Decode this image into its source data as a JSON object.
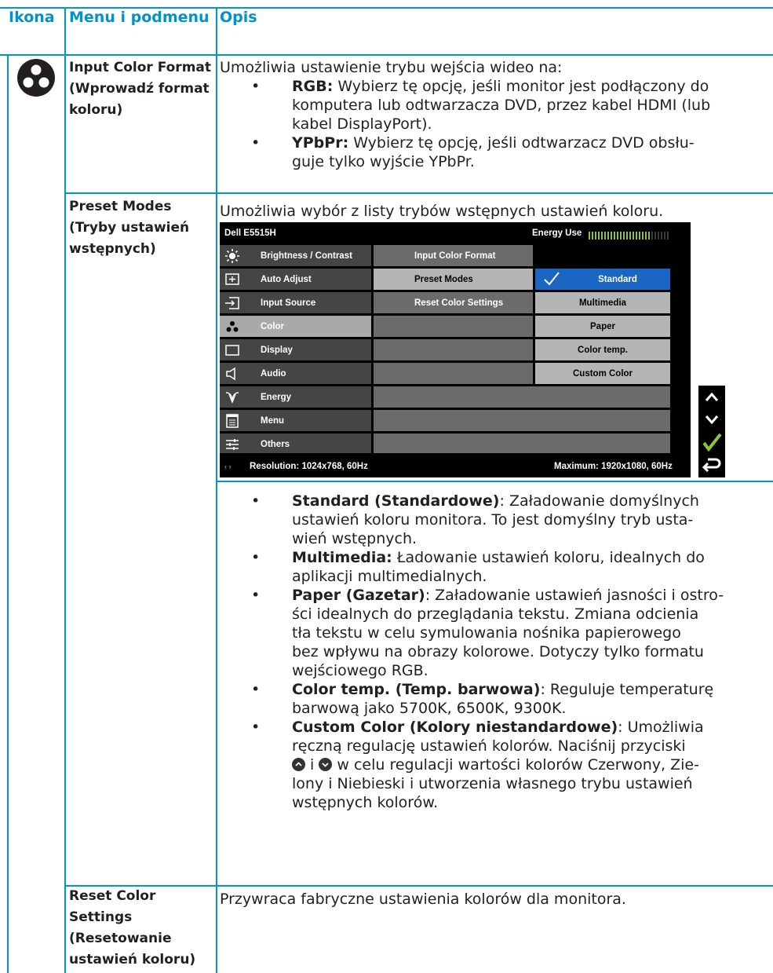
{
  "headers": {
    "icon": "Ikona",
    "menu": "Menu i podmenu",
    "desc": "Opis"
  },
  "row1": {
    "icon": "color-dots-icon",
    "menu": "Input Color Format (Wprowadź format koloru)",
    "intro": "Umożliwia ustawienie trybu wejścia wideo na:",
    "bullets": [
      {
        "term": "RGB:",
        "line1": " Wybierz tę opcję, jeśli monitor jest podłączony do",
        "line2": "komputera lub odtwarzacza DVD, przez kabel HDMI (lub",
        "line3": "kabel DisplayPort)."
      },
      {
        "term": "YPbPr:",
        "line1": " Wybierz tę opcję, jeśli odtwarzacz DVD obsłu-",
        "line2": "guje tylko wyjście YPbPr."
      }
    ]
  },
  "row2": {
    "menu": "Preset Modes (Tryby ustawień wstępnych)",
    "intro": "Umożliwia wybór z listy trybów wstępnych ustawień koloru.",
    "osd": {
      "model": "Dell E5515H",
      "energy_label": "Energy Use",
      "energy_level": 0.78,
      "menu_items": [
        {
          "label": "Brightness / Contrast",
          "icon": "brightness-icon"
        },
        {
          "label": "Auto Adjust",
          "icon": "auto-adjust-icon"
        },
        {
          "label": "Input Source",
          "icon": "input-source-icon"
        },
        {
          "label": "Color",
          "icon": "color-dots-icon"
        },
        {
          "label": "Display",
          "icon": "display-icon"
        },
        {
          "label": "Audio",
          "icon": "audio-icon"
        },
        {
          "label": "Energy",
          "icon": "energy-icon"
        },
        {
          "label": "Menu",
          "icon": "menu-icon"
        },
        {
          "label": "Others",
          "icon": "others-icon"
        }
      ],
      "color_submenu": [
        "Input Color Format",
        "Preset Modes",
        "Reset Color Settings"
      ],
      "preset_options": [
        "Standard",
        "Multimedia",
        "Paper",
        "Color temp.",
        "Custom Color"
      ],
      "resolution": "Resolution: 1024x768, 60Hz",
      "maximum": "Maximum: 1920x1080, 60Hz",
      "nav_buttons": [
        "up-arrow-icon",
        "down-arrow-icon",
        "check-icon",
        "back-icon"
      ]
    },
    "bullets": [
      {
        "term": "Standard (Standardowe)",
        "lines": [
          ": Załadowanie domyślnych",
          "ustawień koloru monitora. To jest domyślny tryb usta-",
          "wień wstępnych."
        ]
      },
      {
        "term": "Multimedia:",
        "lines": [
          " Ładowanie ustawień koloru, idealnych do",
          "aplikacji multimedialnych."
        ]
      },
      {
        "term": "Paper (Gazetar)",
        "lines": [
          ": Załadowanie ustawień jasności i ostro-",
          "ści idealnych do przeglądania tekstu. Zmiana odcienia",
          "tła tekstu w celu symulowania nośnika papierowego",
          "bez wpływu na obrazy kolorowe. Dotyczy tylko formatu",
          "wejściowego RGB."
        ]
      },
      {
        "term": "Color temp. (Temp. barwowa)",
        "lines": [
          ": Reguluje temperaturę",
          "barwową jako 5700K, 6500K, 9300K."
        ]
      },
      {
        "term": "Custom Color (Kolory niestandardowe)",
        "lines": [
          ": Umożliwia",
          "ręczną regulację ustawień kolorów. Naciśnij przyciski"
        ],
        "line_icons_a": " i ",
        "line_icons_b": " w celu regulacji wartości kolorów Czerwony, Zie-",
        "lines2": [
          "lony i Niebieski i utworzenia własnego trybu ustawień",
          "wstępnych kolorów."
        ]
      }
    ]
  },
  "row3": {
    "menu": "Reset Color Settings (Resetowanie ustawień koloru)",
    "desc": "Przywraca fabryczne ustawienia kolorów dla monitora."
  },
  "colors": {
    "accent": "#0098c8",
    "header_text": "#0093c9",
    "osd_highlight": "#1a66c2"
  }
}
